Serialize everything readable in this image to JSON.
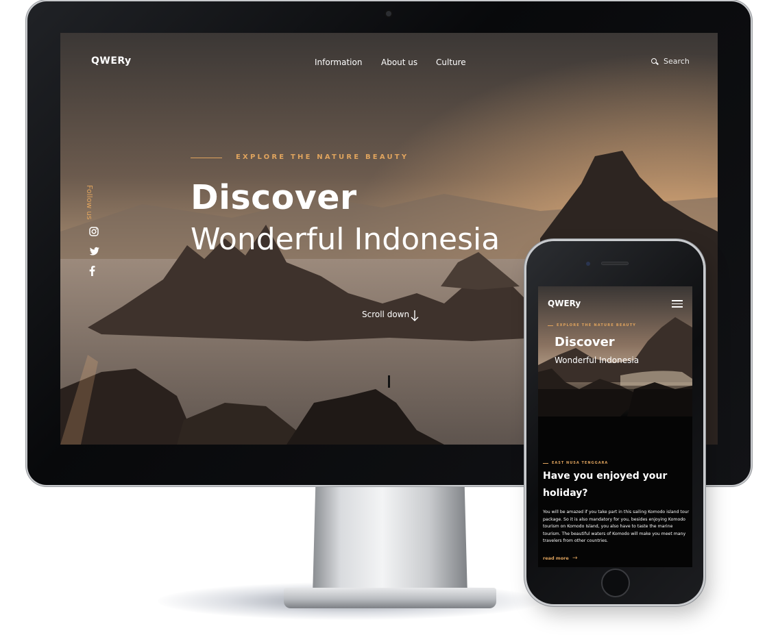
{
  "desktop": {
    "logo": "QWERy",
    "nav": [
      "Information",
      "About us",
      "Culture"
    ],
    "search_label": "Search",
    "tagline": "EXPLORE THE NATURE BEAUTY",
    "hero_title": "Discover",
    "hero_subtitle": "Wonderful Indonesia",
    "scroll_label": "Scroll down",
    "follow_label": "Follow us",
    "social_icons": [
      "instagram-icon",
      "twitter-icon",
      "facebook-icon"
    ]
  },
  "mobile": {
    "logo": "QWERy",
    "tagline": "EXPLORE THE NATURE BEAUTY",
    "hero_title": "Discover",
    "hero_subtitle": "Wonderful Indonesia",
    "region": "EAST NUSA TENGGARA",
    "heading": "Have you enjoyed your holiday?",
    "body": "You will be amazed if you take part in this sailing Komodo island tour package. So it is also mandatory for you, besides enjoying Komodo tourism on Komodo Island, you also have to taste the marine tourism. The beautiful waters of Komodo will make you meet many travelers from other countries.",
    "read_more": "read more"
  },
  "colors": {
    "accent": "#e0a45e",
    "text": "#ffffff",
    "device_frame": "#0c0d0f"
  }
}
